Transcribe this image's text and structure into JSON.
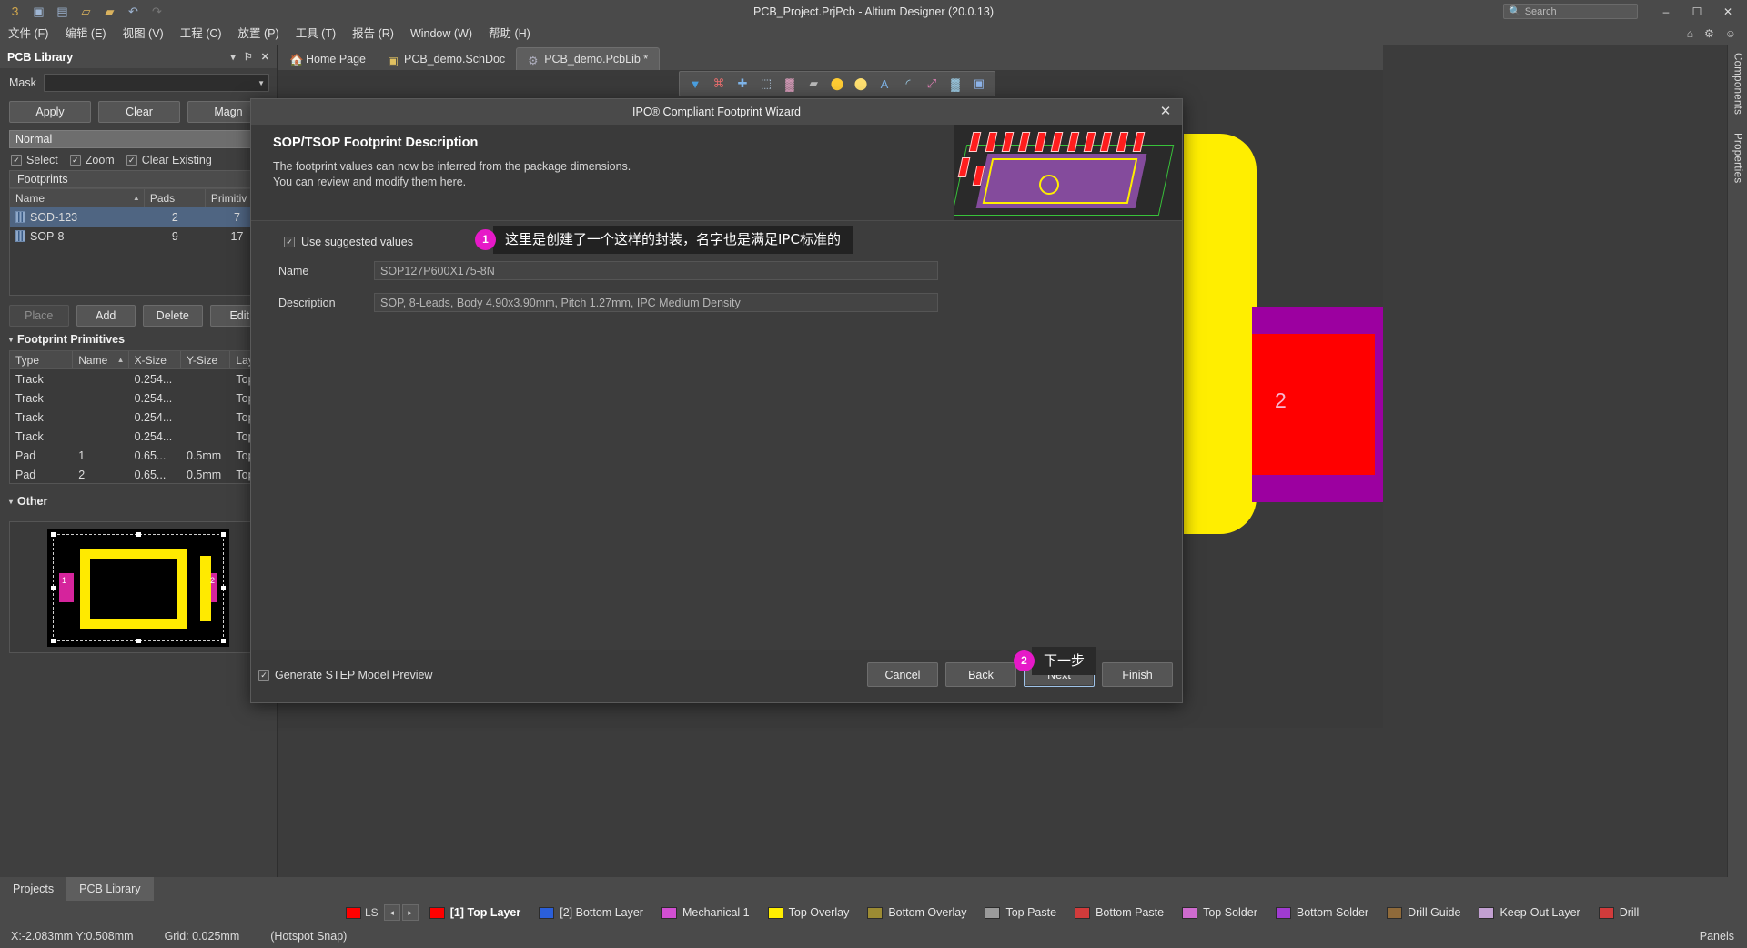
{
  "titlebar": {
    "app_title": "PCB_Project.PrjPcb - Altium Designer (20.0.13)",
    "quick_access": [
      {
        "name": "altium-logo-icon",
        "glyph": "З"
      },
      {
        "name": "save-icon",
        "glyph": "▣"
      },
      {
        "name": "save-all-icon",
        "glyph": "▤"
      },
      {
        "name": "open-icon",
        "glyph": "▱"
      },
      {
        "name": "open-project-icon",
        "glyph": "▰"
      },
      {
        "name": "undo-icon",
        "glyph": "↶"
      },
      {
        "name": "redo-icon",
        "glyph": "↷"
      }
    ],
    "search_placeholder": "Search",
    "minimize_label": "–",
    "maximize_label": "☐",
    "close_label": "✕"
  },
  "menubar": {
    "items": [
      {
        "label": "文件 (F)"
      },
      {
        "label": "编辑 (E)"
      },
      {
        "label": "视图 (V)"
      },
      {
        "label": "工程 (C)"
      },
      {
        "label": "放置 (P)"
      },
      {
        "label": "工具 (T)"
      },
      {
        "label": "报告 (R)"
      },
      {
        "label": "Window (W)"
      },
      {
        "label": "帮助 (H)"
      }
    ],
    "right_icons": [
      {
        "name": "home-icon",
        "glyph": "⌂"
      },
      {
        "name": "gear-icon",
        "glyph": "⚙"
      },
      {
        "name": "user-icon",
        "glyph": "☺"
      }
    ]
  },
  "left_panel": {
    "title": "PCB Library",
    "header_controls": [
      {
        "name": "panel-dropdown-icon",
        "glyph": "▾"
      },
      {
        "name": "panel-pin-icon",
        "glyph": "⚐"
      },
      {
        "name": "panel-close-icon",
        "glyph": "✕"
      }
    ],
    "mask_label": "Mask",
    "mask_value": "",
    "buttons": [
      {
        "label": "Apply",
        "name": "apply-button"
      },
      {
        "label": "Clear",
        "name": "clear-button"
      },
      {
        "label": "Magn",
        "name": "magnify-button"
      }
    ],
    "normal_value": "Normal",
    "checkboxes": [
      {
        "label": "Select",
        "checked": true
      },
      {
        "label": "Zoom",
        "checked": true
      },
      {
        "label": "Clear Existing",
        "checked": true
      }
    ],
    "footprints_section": "Footprints",
    "footprints_columns": [
      "Name",
      "Pads",
      "Primitiv"
    ],
    "footprints_rows": [
      {
        "name": "SOD-123",
        "pads": "2",
        "primitives": "7",
        "selected": true
      },
      {
        "name": "SOP-8",
        "pads": "9",
        "primitives": "17",
        "selected": false
      }
    ],
    "list_buttons": [
      {
        "label": "Place",
        "name": "place-button",
        "disabled": true
      },
      {
        "label": "Add",
        "name": "add-button",
        "disabled": false
      },
      {
        "label": "Delete",
        "name": "delete-button",
        "disabled": false
      },
      {
        "label": "Edit",
        "name": "edit-button",
        "disabled": false
      }
    ],
    "primitives_section": "Footprint Primitives",
    "primitives_columns": [
      "Type",
      "Name",
      "X-Size",
      "Y-Size",
      "Layer"
    ],
    "primitives_rows": [
      {
        "type": "Track",
        "name": "",
        "x": "0.254...",
        "y": "",
        "layer": "Top."
      },
      {
        "type": "Track",
        "name": "",
        "x": "0.254...",
        "y": "",
        "layer": "Top."
      },
      {
        "type": "Track",
        "name": "",
        "x": "0.254...",
        "y": "",
        "layer": "Top."
      },
      {
        "type": "Track",
        "name": "",
        "x": "0.254...",
        "y": "",
        "layer": "Top."
      },
      {
        "type": "Pad",
        "name": "1",
        "x": "0.65...",
        "y": "0.5mm",
        "layer": "Top"
      },
      {
        "type": "Pad",
        "name": "2",
        "x": "0.65...",
        "y": "0.5mm",
        "layer": "Top"
      }
    ],
    "other_section": "Other",
    "preview_pad_labels": [
      "1",
      "2"
    ]
  },
  "tabs": [
    {
      "label": "Home Page",
      "icon": "home-icon",
      "active": false,
      "modified": false
    },
    {
      "label": "PCB_demo.SchDoc",
      "icon": "schematic-icon",
      "active": false,
      "modified": false
    },
    {
      "label": "PCB_demo.PcbLib *",
      "icon": "pcblib-icon",
      "active": true,
      "modified": true
    }
  ],
  "toolstrip": {
    "tools": [
      {
        "name": "filter-icon",
        "glyph": "▼",
        "color": "#4a9fe0"
      },
      {
        "name": "net-icon",
        "glyph": "⌘",
        "color": "#e06c6c"
      },
      {
        "name": "crosshair-icon",
        "glyph": "✚",
        "color": "#7fb5ea"
      },
      {
        "name": "select-rect-icon",
        "glyph": "⬚",
        "color": "#b9d2ea"
      },
      {
        "name": "layer-stack-icon",
        "glyph": "▓",
        "color": "#e0a0c0"
      },
      {
        "name": "polygon-icon",
        "glyph": "▰",
        "color": "#b9b9b9"
      },
      {
        "name": "via-icon",
        "glyph": "⬤",
        "color": "#ffcc33"
      },
      {
        "name": "pad-icon",
        "glyph": "⬤",
        "color": "#ffe070"
      },
      {
        "name": "text-icon",
        "glyph": "A",
        "color": "#7fb5ea"
      },
      {
        "name": "arc-icon",
        "glyph": "◜",
        "color": "#9fd0ea"
      },
      {
        "name": "dimension-icon",
        "glyph": "⤢",
        "color": "#e07fb5"
      },
      {
        "name": "chart-icon",
        "glyph": "▓",
        "color": "#9fd0ea"
      },
      {
        "name": "board-icon",
        "glyph": "▣",
        "color": "#8fb5ea"
      }
    ]
  },
  "right_rail": {
    "items": [
      {
        "label": "Components"
      },
      {
        "label": "Properties"
      }
    ]
  },
  "dialog": {
    "title": "IPC® Compliant Footprint Wizard",
    "close_label": "✕",
    "heading": "SOP/TSOP Footprint Description",
    "sub_line1": "The footprint values can now be inferred from the package dimensions.",
    "sub_line2": "You can review and modify them here.",
    "use_suggested_label": "Use suggested values",
    "use_suggested_checked": true,
    "fields": [
      {
        "label": "Name",
        "value": "SOP127P600X175-8N",
        "name": "footprint-name-field"
      },
      {
        "label": "Description",
        "value": "SOP, 8-Leads, Body 4.90x3.90mm, Pitch 1.27mm, IPC Medium Density",
        "name": "footprint-description-field"
      }
    ],
    "generate_step_label": "Generate STEP Model Preview",
    "generate_step_checked": true,
    "buttons": [
      {
        "label": "Cancel",
        "name": "cancel-button",
        "focus": false
      },
      {
        "label": "Back",
        "name": "back-button",
        "focus": false
      },
      {
        "label": "Next",
        "name": "next-button",
        "focus": true
      },
      {
        "label": "Finish",
        "name": "finish-button",
        "focus": false
      }
    ]
  },
  "annotations": [
    {
      "number": "1",
      "text": "这里是创建了一个这样的封装，名字也是满足IPC标准的"
    },
    {
      "number": "2",
      "text": "下一步"
    }
  ],
  "bottom_tabs": [
    {
      "label": "Projects",
      "active": false
    },
    {
      "label": "PCB Library",
      "active": true
    }
  ],
  "layerbar": {
    "selected_swatch_color": "#ff0000",
    "selected_label": "LS",
    "nav_prev": "◂",
    "nav_next": "▸",
    "layers": [
      {
        "label": "[1] Top Layer",
        "color": "#ff0000",
        "active": true
      },
      {
        "label": "[2] Bottom Layer",
        "color": "#2b5fd9",
        "active": false
      },
      {
        "label": "Mechanical 1",
        "color": "#d14fd1",
        "active": false
      },
      {
        "label": "Top Overlay",
        "color": "#ffee00",
        "active": false
      },
      {
        "label": "Bottom Overlay",
        "color": "#9c8b33",
        "active": false
      },
      {
        "label": "Top Paste",
        "color": "#9a9a9a",
        "active": false
      },
      {
        "label": "Bottom Paste",
        "color": "#d13b3b",
        "active": false
      },
      {
        "label": "Top Solder",
        "color": "#cf6ccf",
        "active": false
      },
      {
        "label": "Bottom Solder",
        "color": "#a03bd1",
        "active": false
      },
      {
        "label": "Drill Guide",
        "color": "#8f6a3a",
        "active": false
      },
      {
        "label": "Keep-Out Layer",
        "color": "#c2a0d1",
        "active": false
      },
      {
        "label": "Drill",
        "color": "#d13b3b",
        "active": false
      }
    ]
  },
  "statusbar": {
    "coords": "X:-2.083mm Y:0.508mm",
    "grid": "Grid: 0.025mm",
    "snap": "(Hotspot Snap)",
    "panels_label": "Panels"
  }
}
